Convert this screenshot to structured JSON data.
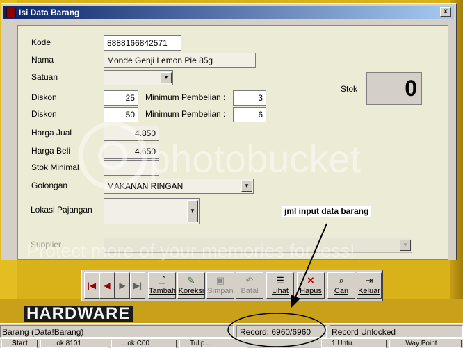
{
  "window": {
    "title": "Isi Data Barang",
    "close_symbol": "x"
  },
  "form": {
    "kode_label": "Kode",
    "kode_value": "8888166842571",
    "nama_label": "Nama",
    "nama_value": "Monde Genji Lemon Pie 85g",
    "satuan_label": "Satuan",
    "satuan_value": "",
    "diskon1_label": "Diskon",
    "diskon1_value": "25",
    "min1_label": "Minimum Pembelian :",
    "min1_value": "3",
    "diskon2_label": "Diskon",
    "diskon2_value": "50",
    "min2_label": "Minimum Pembelian :",
    "min2_value": "6",
    "harga_jual_label": "Harga Jual",
    "harga_jual_value": "4.850",
    "harga_beli_label": "Harga Beli",
    "harga_beli_value": "4.650",
    "stok_minimal_label": "Stok Minimal",
    "stok_minimal_value": "",
    "golongan_label": "Golongan",
    "golongan_value": "MAKANAN RINGAN",
    "lokasi_label": "Lokasi Pajangan",
    "lokasi_value": "",
    "supplier_label": "Supplier",
    "supplier_value": "",
    "stok_label": "Stok",
    "stok_value": "0"
  },
  "toolbar": {
    "tambah": "Tambah",
    "koreksi": "Koreksi",
    "simpan": "Simpan",
    "batal": "Batal",
    "lihat": "Lihat",
    "hapus": "Hapus",
    "cari": "Cari",
    "keluar": "Keluar"
  },
  "background": {
    "hardware_text": "HARDWARE"
  },
  "annotation": {
    "label": "jml input data barang"
  },
  "status": {
    "left": "Barang (Data!Barang)",
    "record": "Record: 6960/6960",
    "lock": "Record Unlocked"
  },
  "taskbar": {
    "items": [
      "Start",
      "...ok 8101",
      "...ok C00",
      "Tulip...",
      "1 Untu...",
      "...Way Point"
    ]
  },
  "watermark": {
    "brand": "photobucket",
    "tagline": "Protect more of your memories for less!"
  },
  "colors": {
    "title_start": "#0a246a",
    "title_end": "#a6caf0",
    "panel": "#ecebd6",
    "desktop": "#d9b21a"
  }
}
